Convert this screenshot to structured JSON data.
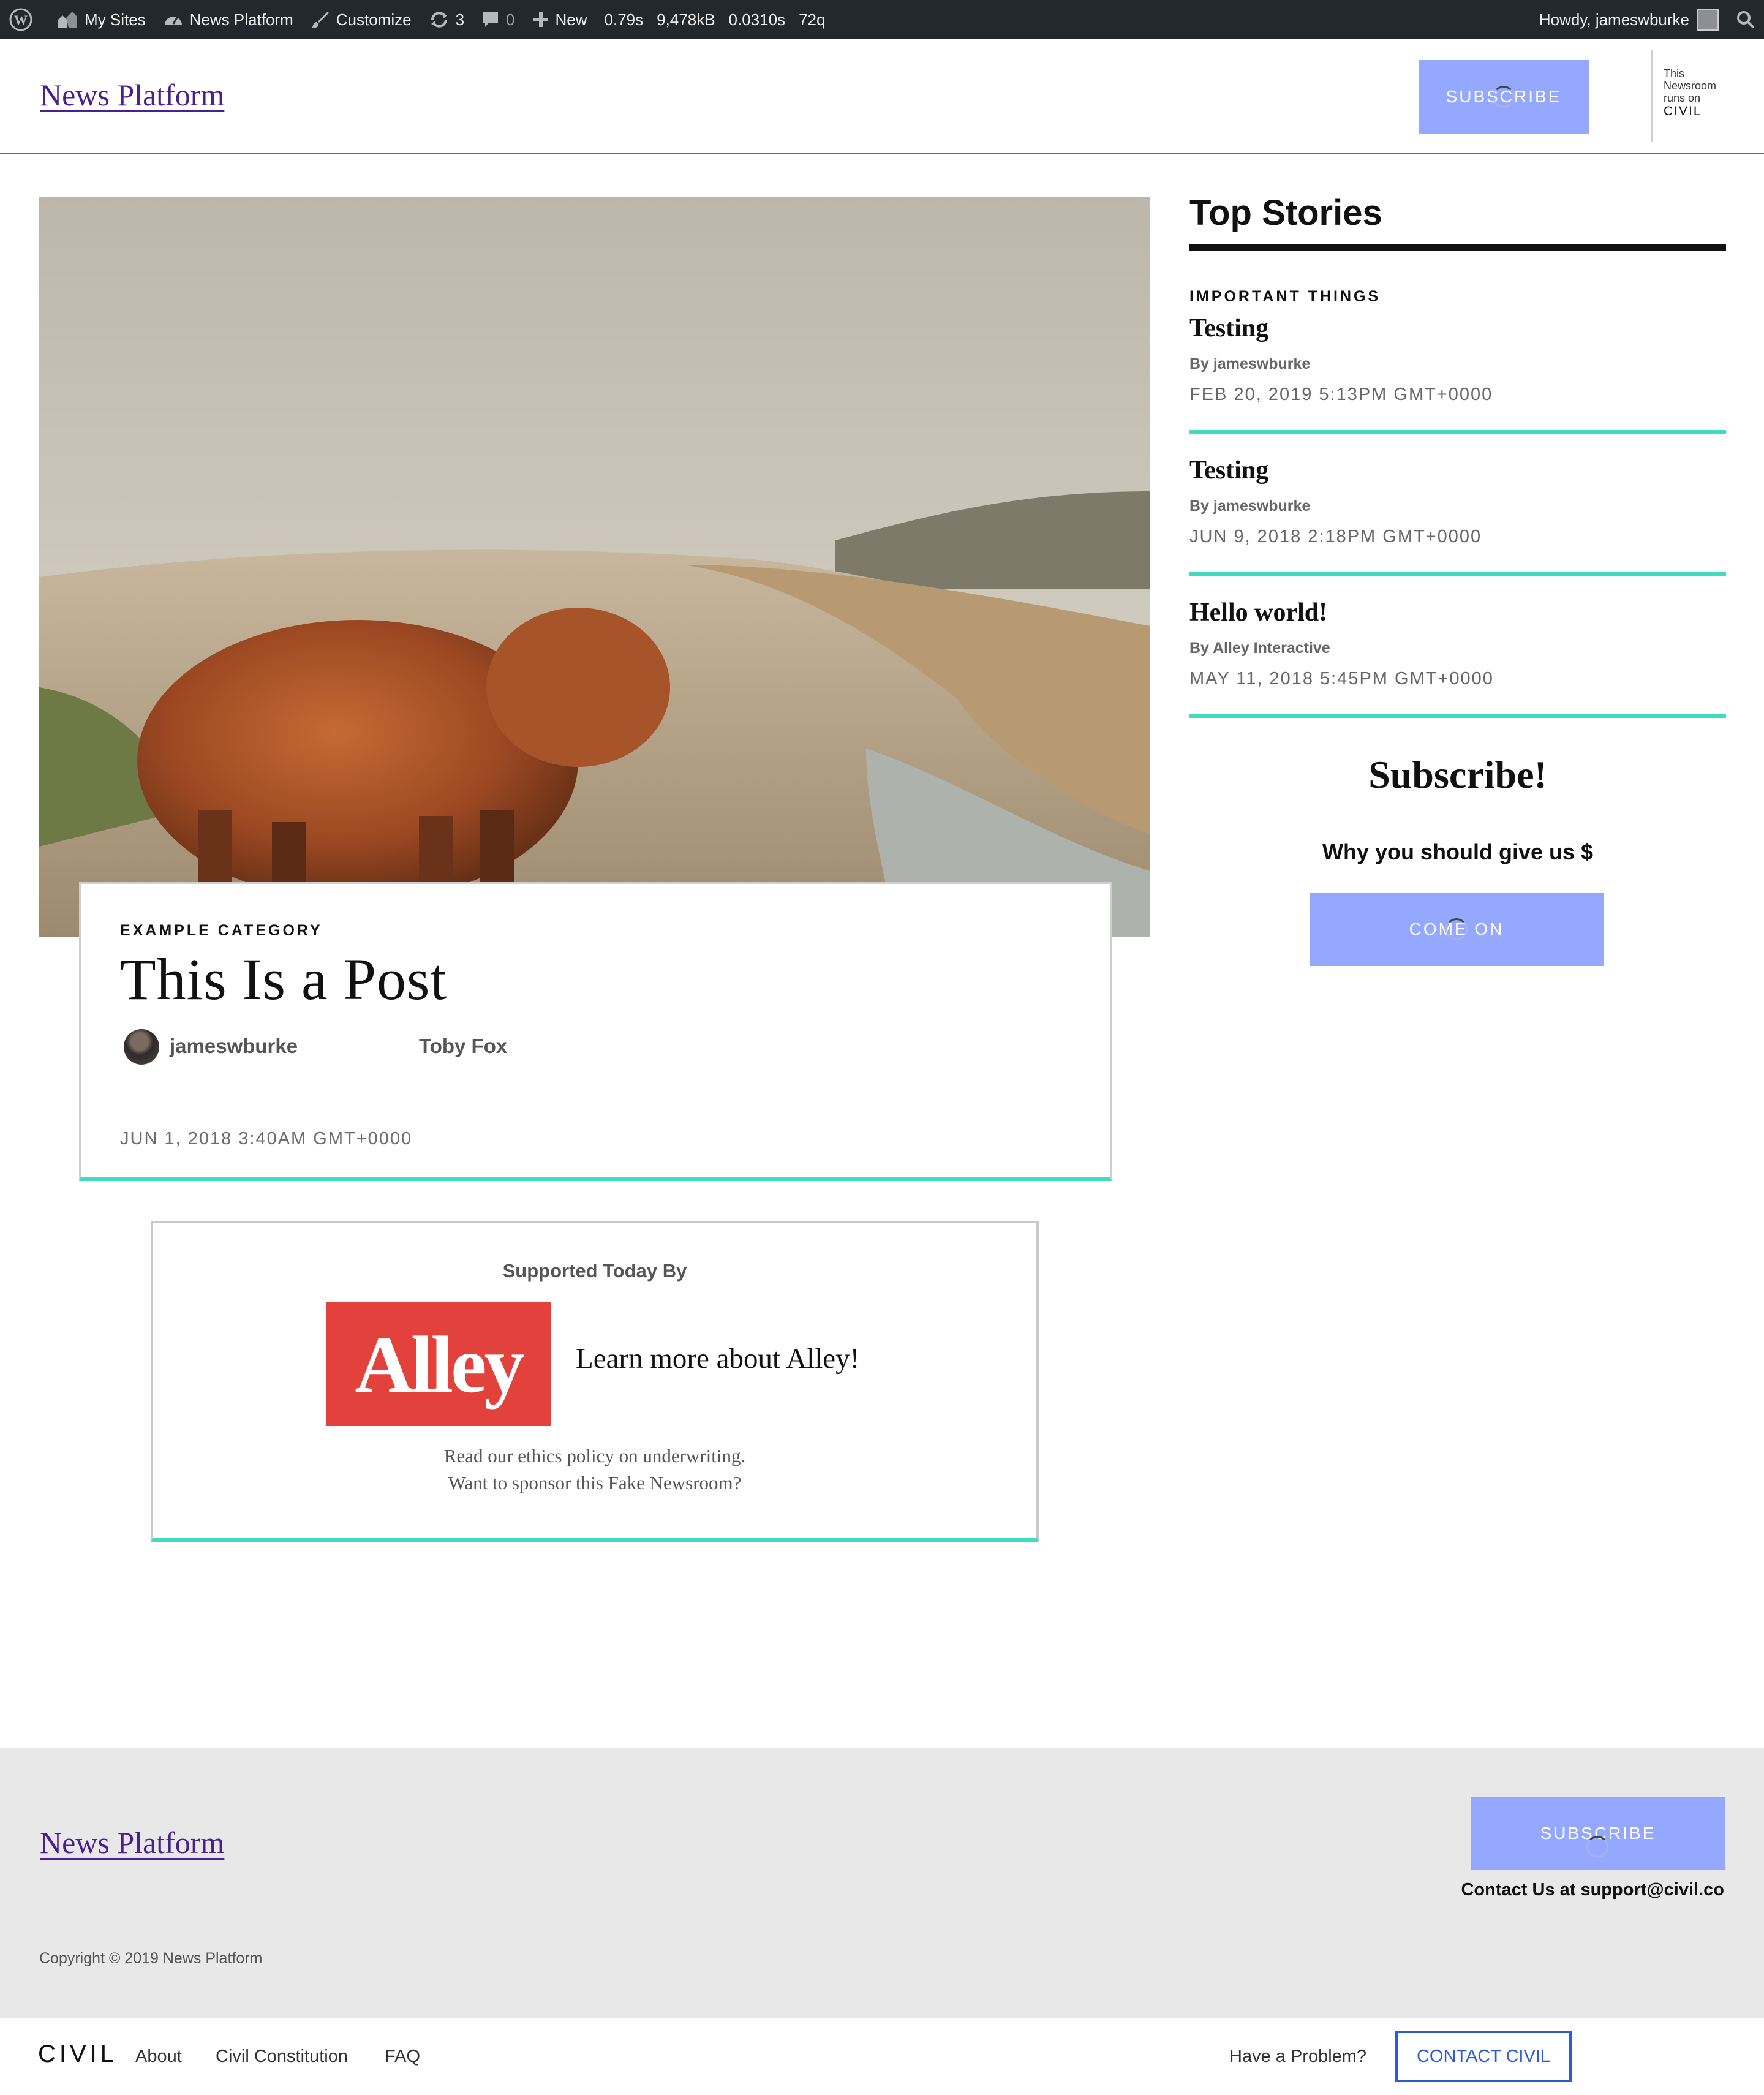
{
  "admin_bar": {
    "my_sites": "My Sites",
    "site_name": "News Platform",
    "customize": "Customize",
    "updates_count": "3",
    "comments_count": "0",
    "new_label": "New",
    "metric_time": "0.79s",
    "metric_memory": "9,478kB",
    "metric_query_time": "0.0310s",
    "metric_queries": "72q",
    "howdy": "Howdy, jameswburke"
  },
  "header": {
    "site_title": "News Platform",
    "subscribe_label": "SUBSCRIBE",
    "civil_badge_lines": [
      "This",
      "Newsroom",
      "runs on"
    ],
    "civil_badge_brand": "CIVIL"
  },
  "post": {
    "category": "EXAMPLE CATEGORY",
    "title": "This Is a Post",
    "author": "jameswburke",
    "coauthor": "Toby Fox",
    "date": "JUN 1, 2018 3:40AM GMT+0000"
  },
  "sponsor": {
    "heading": "Supported Today By",
    "logo_text": "Alley",
    "link_text": "Learn more about Alley!",
    "note_line1": "Read our ethics policy on underwriting.",
    "note_line2": "Want to sponsor this Fake Newsroom?"
  },
  "sidebar": {
    "top_stories_title": "Top Stories",
    "stories": [
      {
        "category": "IMPORTANT THINGS",
        "title": "Testing",
        "byline": "By jameswburke",
        "date": "FEB 20, 2019 5:13PM GMT+0000"
      },
      {
        "category": "",
        "title": "Testing",
        "byline": "By jameswburke",
        "date": "JUN 9, 2018 2:18PM GMT+0000"
      },
      {
        "category": "",
        "title": "Hello world!",
        "byline": "By Alley Interactive",
        "date": "MAY 11, 2018 5:45PM GMT+0000"
      }
    ],
    "subscribe_title": "Subscribe!",
    "subscribe_text": "Why you should give us $",
    "subscribe_button": "COME ON"
  },
  "footer": {
    "site_title": "News Platform",
    "subscribe_label": "SUBSCRIBE",
    "contact_text": "Contact Us at support@civil.co",
    "copyright": "Copyright © 2019 News Platform"
  },
  "civil_bar": {
    "logo": "CIVIL",
    "links": [
      "About",
      "Civil Constitution",
      "FAQ"
    ],
    "problem_text": "Have a Problem?",
    "contact_button": "CONTACT CIVIL"
  },
  "colors": {
    "admin_bar_bg": "#23282d",
    "button_accent": "#94a8ff",
    "rule_accent": "#3fdcbf",
    "link_purple": "#4b1f8f",
    "alley_red": "#e2423b",
    "contact_blue": "#2b5bd7"
  }
}
